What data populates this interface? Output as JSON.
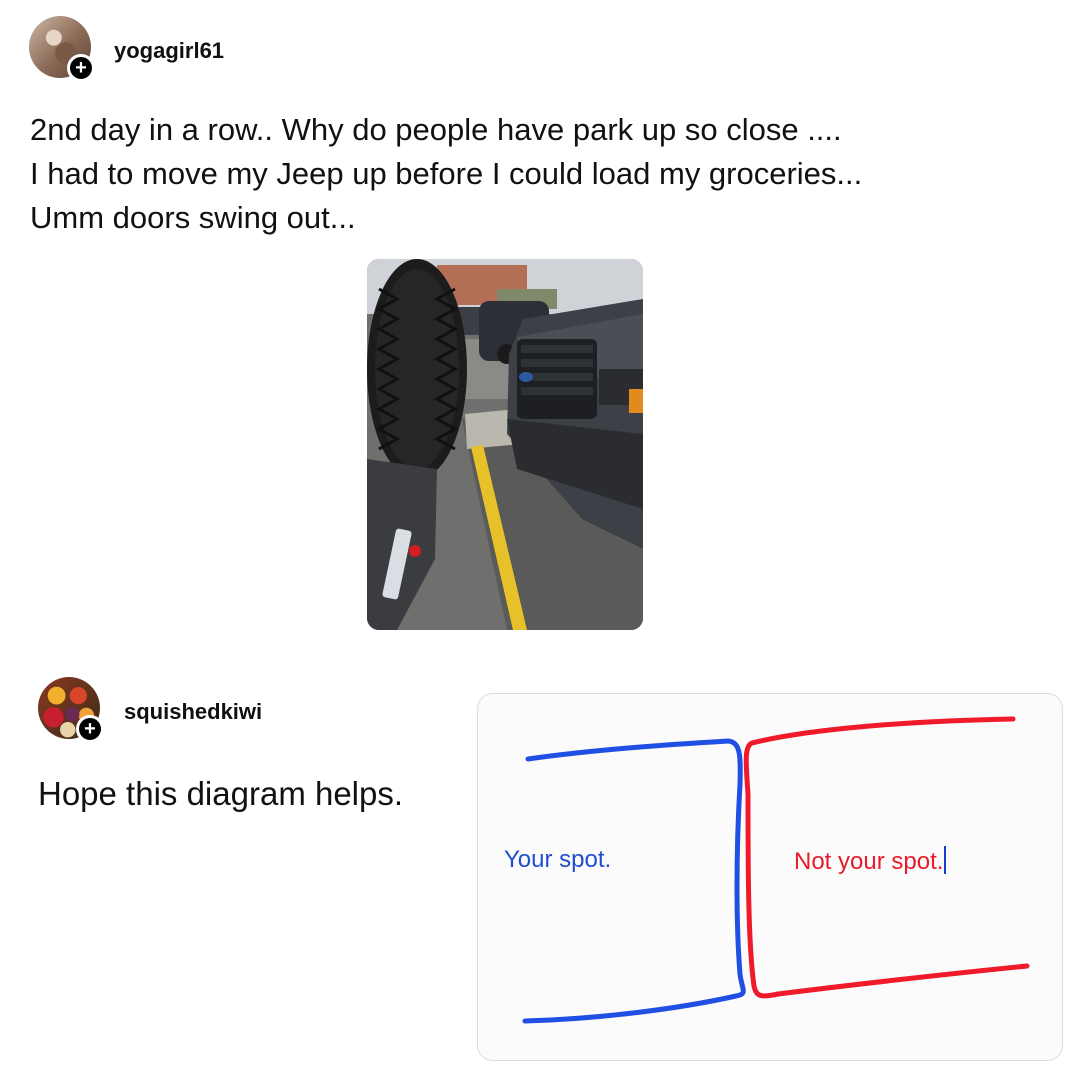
{
  "post": {
    "username": "yogagirl61",
    "text_lines": [
      "2nd day in a row.. Why do people have park up so close ....",
      "I had to move my Jeep up before I could load my groceries...",
      "Umm doors swing out..."
    ]
  },
  "reply": {
    "username": "squishedkiwi",
    "text": "Hope this diagram helps.",
    "diagram": {
      "left_label": "Your spot.",
      "right_label": "Not your spot.",
      "left_color": "#1f4fd1",
      "right_color": "#e81c2a",
      "left_line_color": "#1f4fe3",
      "right_line_color": "#f01a2b"
    }
  },
  "badge": {
    "symbol": "+",
    "icon": "plus-icon"
  }
}
